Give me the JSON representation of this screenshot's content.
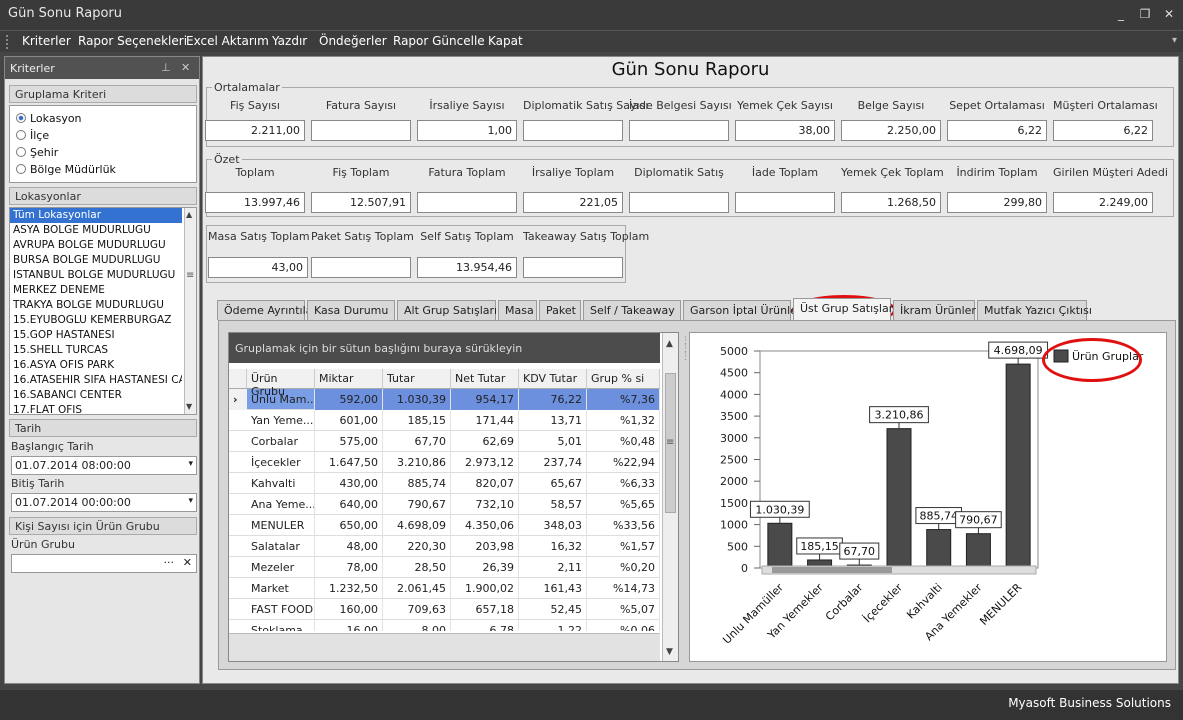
{
  "window": {
    "title": "Gün Sonu Raporu",
    "minimize": "_",
    "restore": "❐",
    "close": "✕"
  },
  "menu": [
    "Kriterler",
    "Rapor Seçenekleri",
    "Excel Aktarım",
    "Yazdır",
    "Öndeğerler",
    "Rapor Güncelle",
    "Kapat"
  ],
  "left_panel": {
    "title": "Kriterler",
    "pin_icon": "pin-icon",
    "close_icon": "close-icon",
    "gruplama_title": "Gruplama Kriteri",
    "gruplama_options": [
      "Lokasyon",
      "İlçe",
      "Şehir",
      "Bölge Müdürlük"
    ],
    "gruplama_selected": 0,
    "lokasyonlar_title": "Lokasyonlar",
    "lokasyonlar": [
      "Tüm Lokasyonlar",
      "ASYA BOLGE MUDURLUGU",
      "AVRUPA BOLGE MUDURLUGU",
      "BURSA BOLGE MUDURLUGU",
      "ISTANBUL BOLGE MUDURLUGU",
      "MERKEZ DENEME",
      "TRAKYA BOLGE MUDURLUGU",
      "15.EYUBOGLU KEMERBURGAZ",
      "15.GOP HASTANESI",
      "15.SHELL TURCAS",
      "16.ASYA OFIS PARK",
      "16.ATASEHIR SIFA HASTANESI CA",
      "16.SABANCI CENTER",
      "17.FLAT OFIS"
    ],
    "tarih_title": "Tarih",
    "baslangic_label": "Başlangıç Tarih",
    "baslangic_value": "01.07.2014 08:00:00",
    "bitis_label": "Bitiş Tarih",
    "bitis_value": "01.07.2014 00:00:00",
    "kisi_title": "Kişi Sayısı için Ürün Grubu",
    "urun_grubu_label": "Ürün Grubu",
    "urun_grubu_value": ""
  },
  "report": {
    "title": "Gün Sonu Raporu",
    "ortalamalar": {
      "legend": "Ortalamalar",
      "fields": [
        {
          "label": "Fiş Sayısı",
          "value": "2.211,00"
        },
        {
          "label": "Fatura Sayısı",
          "value": ""
        },
        {
          "label": "İrsaliye Sayısı",
          "value": "1,00"
        },
        {
          "label": "Diplomatik Satış Sayısı",
          "value": ""
        },
        {
          "label": "İade Belgesi Sayısı",
          "value": ""
        },
        {
          "label": "Yemek Çek Sayısı",
          "value": "38,00"
        },
        {
          "label": "Belge Sayısı",
          "value": "2.250,00"
        },
        {
          "label": "Sepet Ortalaması",
          "value": "6,22"
        },
        {
          "label": "Müşteri Ortalaması",
          "value": "6,22"
        }
      ]
    },
    "ozet": {
      "legend": "Özet",
      "fields": [
        {
          "label": "Toplam",
          "value": "13.997,46"
        },
        {
          "label": "Fiş Toplam",
          "value": "12.507,91"
        },
        {
          "label": "Fatura Toplam",
          "value": ""
        },
        {
          "label": "İrsaliye Toplam",
          "value": "221,05"
        },
        {
          "label": "Diplomatik Satış",
          "value": ""
        },
        {
          "label": "İade Toplam",
          "value": ""
        },
        {
          "label": "Yemek Çek Toplam",
          "value": "1.268,50"
        },
        {
          "label": "İndirim Toplam",
          "value": "299,80"
        },
        {
          "label": "Girilen Müşteri Adedi",
          "value": "2.249,00"
        }
      ]
    },
    "satis": [
      {
        "label": "Masa Satış Toplam",
        "value": "43,00"
      },
      {
        "label": "Paket Satış Toplam",
        "value": ""
      },
      {
        "label": "Self Satış Toplam",
        "value": "13.954,46"
      },
      {
        "label": "Takeaway Satış Toplam",
        "value": ""
      }
    ]
  },
  "tabs": [
    "Ödeme Ayrıntıları",
    "Kasa Durumu",
    "Alt Grup Satışları",
    "Masa",
    "Paket",
    "Self / Takeaway",
    "Garson İptal Ürünler",
    "Üst Grup Satışları",
    "İkram Ürünler",
    "Mutfak Yazıcı Çıktısı"
  ],
  "active_tab": 7,
  "grid": {
    "group_hint": "Gruplamak için bir sütun başlığını buraya sürükleyin",
    "columns": [
      "Ürün Grubu",
      "Miktar",
      "Tutar",
      "Net Tutar",
      "KDV Tutar",
      "Grup % si"
    ],
    "rows": [
      [
        "Unlu Mam...",
        "592,00",
        "1.030,39",
        "954,17",
        "76,22",
        "%7,36"
      ],
      [
        "Yan Yeme...",
        "601,00",
        "185,15",
        "171,44",
        "13,71",
        "%1,32"
      ],
      [
        "Corbalar",
        "575,00",
        "67,70",
        "62,69",
        "5,01",
        "%0,48"
      ],
      [
        "İçecekler",
        "1.647,50",
        "3.210,86",
        "2.973,12",
        "237,74",
        "%22,94"
      ],
      [
        "Kahvalti",
        "430,00",
        "885,74",
        "820,07",
        "65,67",
        "%6,33"
      ],
      [
        "Ana Yeme...",
        "640,00",
        "790,67",
        "732,10",
        "58,57",
        "%5,65"
      ],
      [
        "MENULER",
        "650,00",
        "4.698,09",
        "4.350,06",
        "348,03",
        "%33,56"
      ],
      [
        "Salatalar",
        "48,00",
        "220,30",
        "203,98",
        "16,32",
        "%1,57"
      ],
      [
        "Mezeler",
        "78,00",
        "28,50",
        "26,39",
        "2,11",
        "%0,20"
      ],
      [
        "Market",
        "1.232,50",
        "2.061,45",
        "1.900,02",
        "161,43",
        "%14,73"
      ],
      [
        "FAST FOOD",
        "160,00",
        "709,63",
        "657,18",
        "52,45",
        "%5,07"
      ],
      [
        "Stoklama",
        "16,00",
        "8,00",
        "6,78",
        "1,22",
        "%0,06"
      ]
    ],
    "selected_row": 0,
    "row_indicator": "›"
  },
  "chart_data": {
    "type": "bar",
    "categories": [
      "Unlu Mamüller",
      "Yan Yemekler",
      "Corbalar",
      "İçecekler",
      "Kahvalti",
      "Ana Yemekler",
      "MENULER"
    ],
    "values": [
      1030.39,
      185.15,
      67.7,
      3210.86,
      885.74,
      790.67,
      4698.09
    ],
    "value_labels": [
      "1.030,39",
      "185,15",
      "67,70",
      "3.210,86",
      "885,74",
      "790,67",
      "4.698,09"
    ],
    "yticks": [
      "5000",
      "4500",
      "4000",
      "3500",
      "3000",
      "2500",
      "2000",
      "1500",
      "1000",
      "500",
      "0"
    ],
    "ylim": [
      0,
      5000
    ],
    "legend": "Ürün Gruplar",
    "legend_position": "top-right",
    "bar_color": "#4a4a4a",
    "grid": false
  },
  "status": {
    "text": "Myasoft Business Solutions"
  },
  "colors": {
    "highlight": "#e01010",
    "selection": "#3472d1",
    "row_selection": "#7a9ee6"
  }
}
